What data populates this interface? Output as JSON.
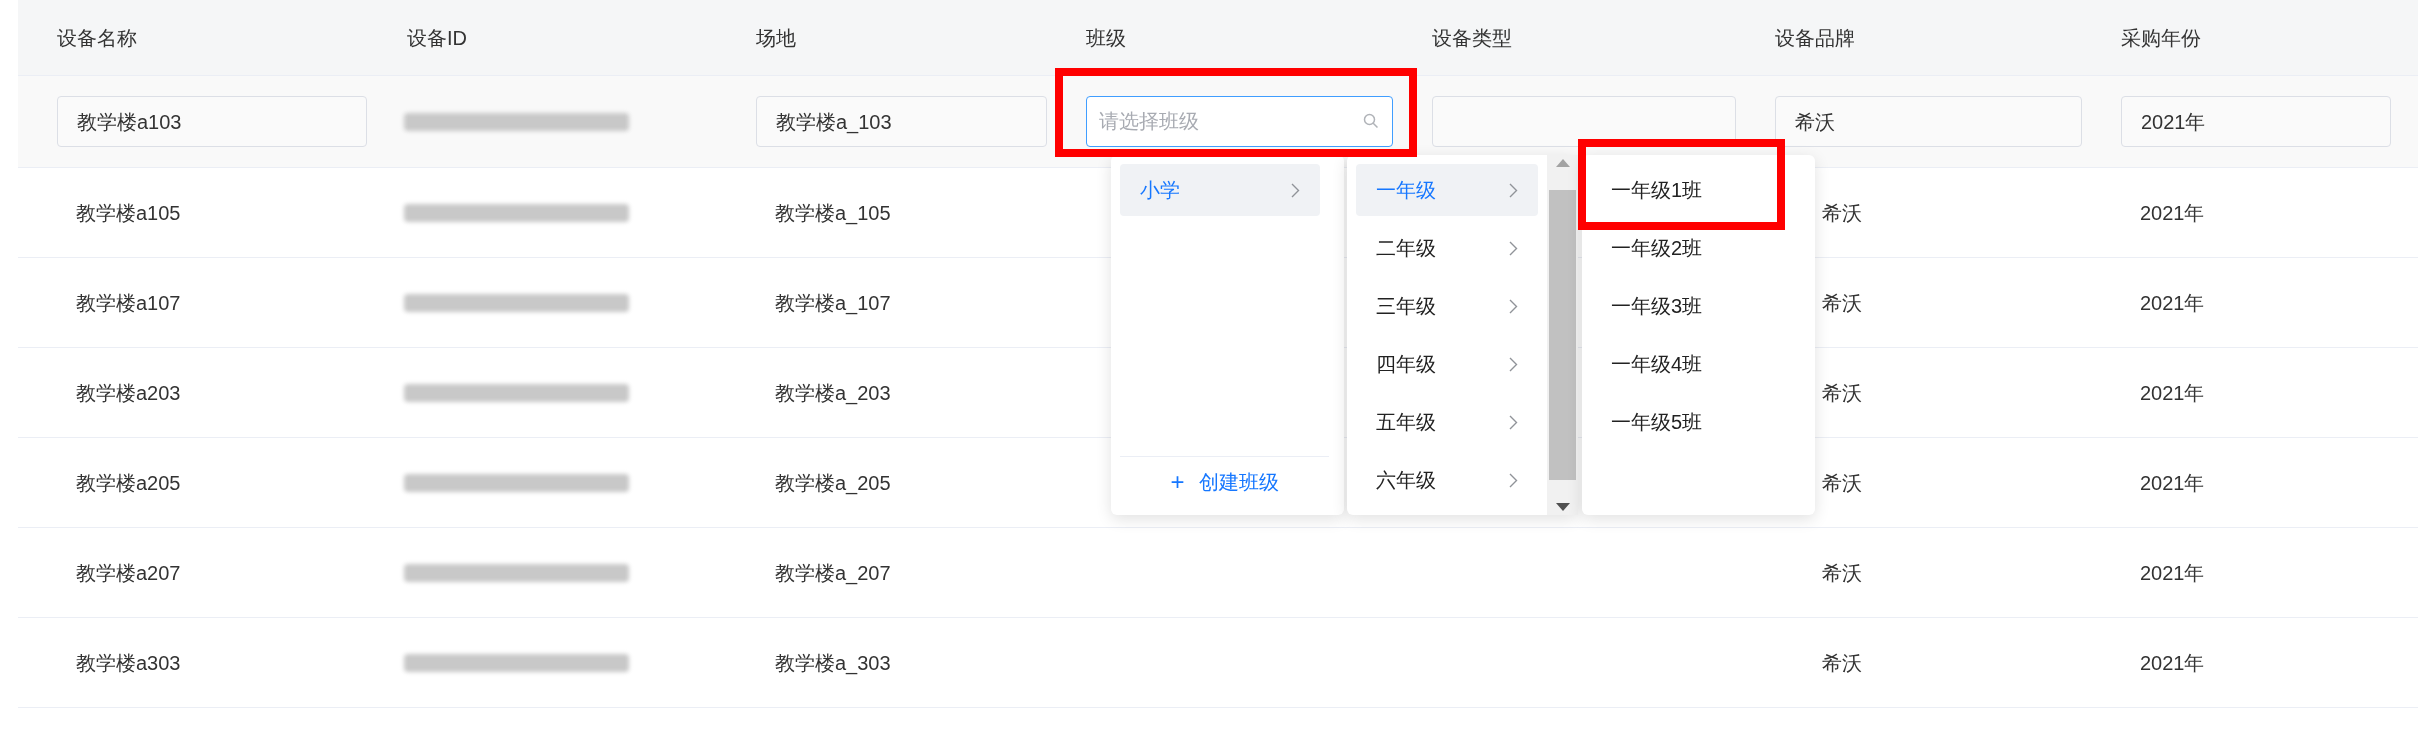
{
  "table": {
    "columns": [
      "设备名称",
      "设备ID",
      "场地",
      "班级",
      "设备类型",
      "设备品牌",
      "采购年份"
    ],
    "edit_row": {
      "name": "教学楼a103",
      "venue": "教学楼a_103",
      "class_placeholder": "请选择班级",
      "brand": "希沃",
      "year": "2021年"
    },
    "rows": [
      {
        "name": "教学楼a105",
        "venue": "教学楼a_105",
        "brand": "希沃",
        "year": "2021年"
      },
      {
        "name": "教学楼a107",
        "venue": "教学楼a_107",
        "brand": "希沃",
        "year": "2021年"
      },
      {
        "name": "教学楼a203",
        "venue": "教学楼a_203",
        "brand": "希沃",
        "year": "2021年"
      },
      {
        "name": "教学楼a205",
        "venue": "教学楼a_205",
        "brand": "希沃",
        "year": "2021年"
      },
      {
        "name": "教学楼a207",
        "venue": "教学楼a_207",
        "brand": "希沃",
        "year": "2021年"
      },
      {
        "name": "教学楼a303",
        "venue": "教学楼a_303",
        "brand": "希沃",
        "year": "2021年"
      }
    ]
  },
  "class_picker": {
    "stages": [
      {
        "label": "小学",
        "selected": true
      }
    ],
    "grades": [
      {
        "label": "一年级",
        "selected": true
      },
      {
        "label": "二年级",
        "selected": false
      },
      {
        "label": "三年级",
        "selected": false
      },
      {
        "label": "四年级",
        "selected": false
      },
      {
        "label": "五年级",
        "selected": false
      },
      {
        "label": "六年级",
        "selected": false
      }
    ],
    "classes": [
      {
        "label": "一年级1班",
        "selected": false
      },
      {
        "label": "一年级2班",
        "selected": false
      },
      {
        "label": "一年级3班",
        "selected": false
      },
      {
        "label": "一年级4班",
        "selected": false
      },
      {
        "label": "一年级5班",
        "selected": false
      }
    ],
    "create_button": {
      "icon": "+",
      "label": "创建班级"
    }
  }
}
